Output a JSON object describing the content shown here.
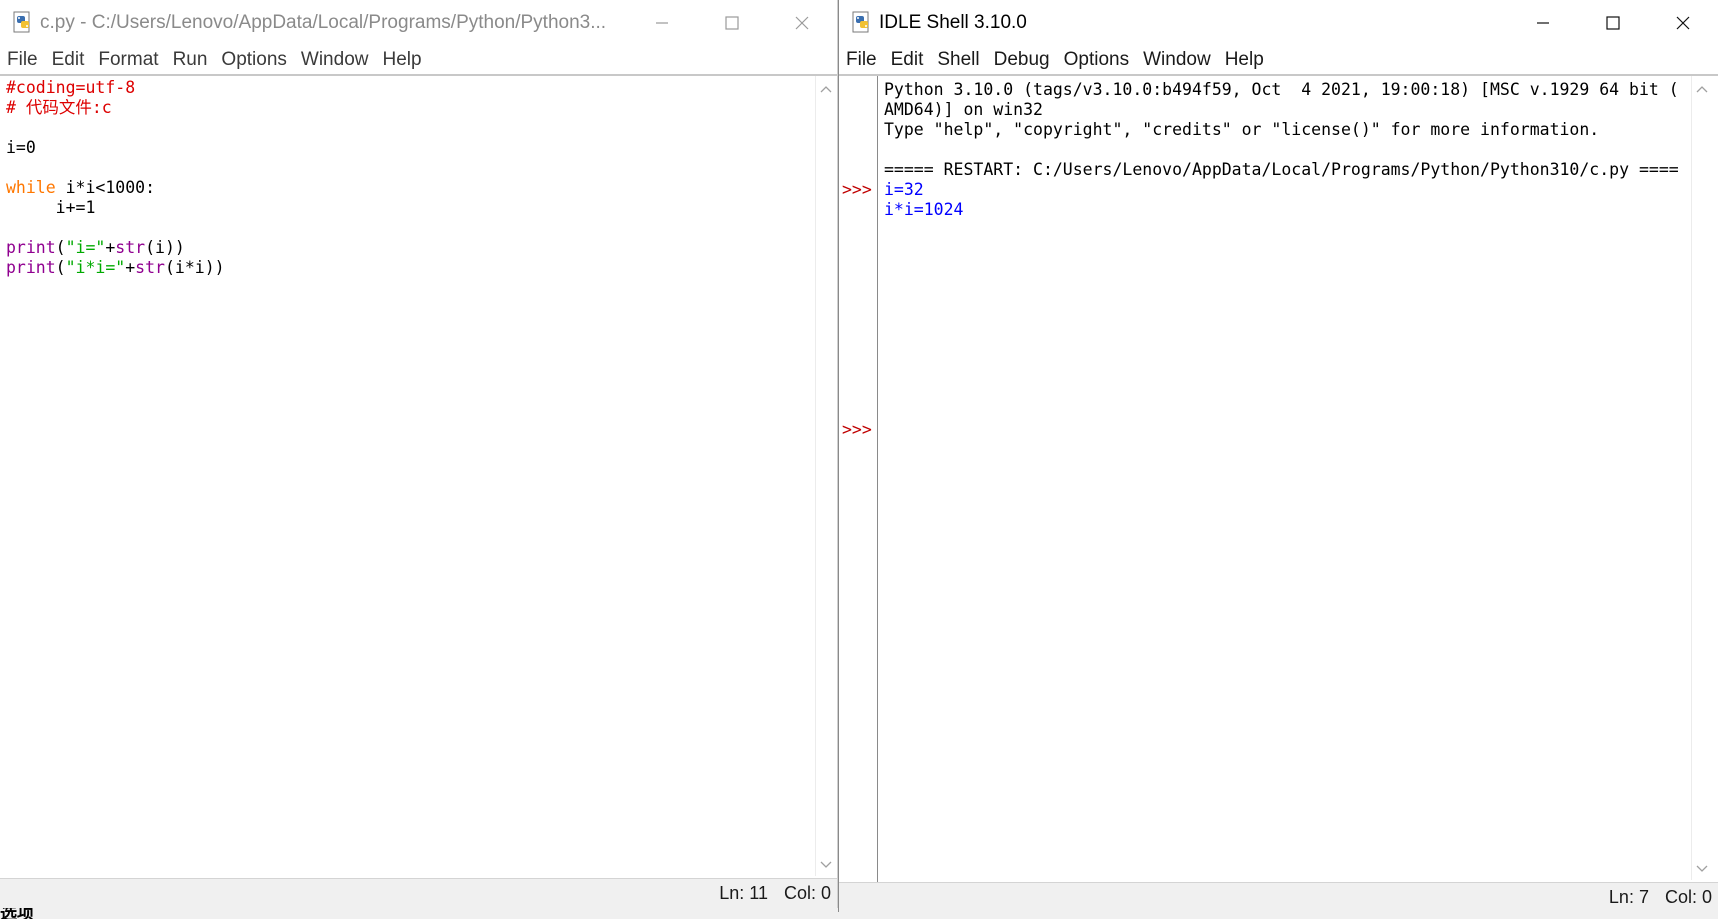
{
  "editor": {
    "title": "c.py - C:/Users/Lenovo/AppData/Local/Programs/Python/Python3...",
    "menu": [
      "File",
      "Edit",
      "Format",
      "Run",
      "Options",
      "Window",
      "Help"
    ],
    "code": [
      [
        {
          "t": "#coding=utf-8",
          "c": "comment"
        }
      ],
      [
        {
          "t": "# 代码文件:c",
          "c": "comment"
        }
      ],
      [],
      [
        {
          "t": "i=0",
          "c": "default"
        }
      ],
      [],
      [
        {
          "t": "while",
          "c": "keyword"
        },
        {
          "t": " i*i<1000:",
          "c": "default"
        }
      ],
      [
        {
          "t": "     i+=1",
          "c": "default"
        }
      ],
      [],
      [
        {
          "t": "print",
          "c": "builtin"
        },
        {
          "t": "(",
          "c": "default"
        },
        {
          "t": "\"i=\"",
          "c": "string"
        },
        {
          "t": "+",
          "c": "default"
        },
        {
          "t": "str",
          "c": "builtin"
        },
        {
          "t": "(i))",
          "c": "default"
        }
      ],
      [
        {
          "t": "print",
          "c": "builtin"
        },
        {
          "t": "(",
          "c": "default"
        },
        {
          "t": "\"i*i=\"",
          "c": "string"
        },
        {
          "t": "+",
          "c": "default"
        },
        {
          "t": "str",
          "c": "builtin"
        },
        {
          "t": "(i*i))",
          "c": "default"
        }
      ]
    ],
    "status": {
      "ln": "Ln: 11",
      "col": "Col: 0"
    }
  },
  "shell": {
    "title": "IDLE Shell 3.10.0",
    "menu": [
      "File",
      "Edit",
      "Shell",
      "Debug",
      "Options",
      "Window",
      "Help"
    ],
    "prompt": ">>>",
    "lines": [
      {
        "t": "Python 3.10.0 (tags/v3.10.0:b494f59, Oct  4 2021, 19:00:18) [MSC v.1929 64 bit (",
        "c": "default"
      },
      {
        "t": "AMD64)] on win32",
        "c": "default"
      },
      {
        "t": "Type \"help\", \"copyright\", \"credits\" or \"license()\" for more information.",
        "c": "default"
      },
      {
        "t": "",
        "c": "default"
      },
      {
        "t": "===== RESTART: C:/Users/Lenovo/AppData/Local/Programs/Python/Python310/c.py ====",
        "c": "default"
      },
      {
        "t": "i=32",
        "c": "out"
      },
      {
        "t": "i*i=1024",
        "c": "out"
      }
    ],
    "status": {
      "ln": "Ln: 7",
      "col": "Col: 0"
    }
  },
  "desktop_fragment": "选项",
  "colors": {
    "comment": "#dd0000",
    "keyword": "#ff7700",
    "builtin": "#900090",
    "string": "#00aa00",
    "output": "#0000ff",
    "prompt": "#c00000"
  },
  "icons": {
    "app": "python-idle-icon",
    "minimize": "minimize-icon",
    "maximize": "maximize-icon",
    "close": "close-icon",
    "scroll_up": "scroll-up-arrow-icon",
    "scroll_down": "scroll-down-arrow-icon"
  }
}
